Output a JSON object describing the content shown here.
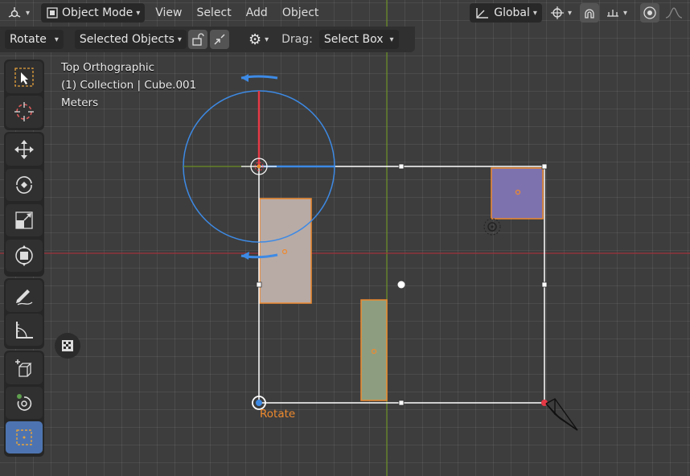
{
  "header": {
    "mode_label": "Object Mode",
    "menu": [
      "View",
      "Select",
      "Add",
      "Object"
    ],
    "orientation_label": "Global",
    "tool_label": "Rotate",
    "affect_label": "Selected Objects",
    "drag_label": "Drag:",
    "drag_value": "Select Box"
  },
  "viewport": {
    "view_name": "Top Orthographic",
    "collection_info": "(1) Collection | Cube.001",
    "units": "Meters",
    "gizmo_label": "Rotate"
  },
  "toolbar": {
    "tools": [
      "select-box",
      "cursor",
      "move",
      "rotate",
      "scale",
      "transform",
      "annotate",
      "measure",
      "add-cube",
      "spin",
      "active-tool"
    ],
    "active_tool": "active-tool"
  },
  "colors": {
    "x_axis": "#a0323c",
    "y_axis": "#6b8f24",
    "selection": "#ef8a2e",
    "gizmo": "#3d8ae5",
    "cube_pink": "#b8aba6",
    "cube_green": "#8d9e80",
    "cube_purple": "#7e72ae"
  }
}
